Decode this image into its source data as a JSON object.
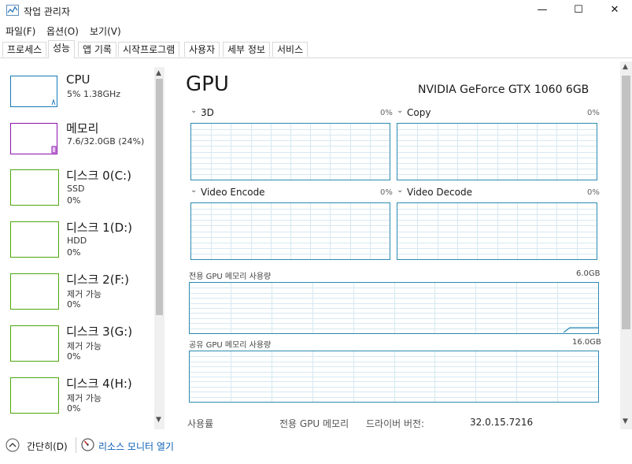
{
  "window": {
    "title": "작업 관리자"
  },
  "menu": [
    "파일(F)",
    "옵션(O)",
    "보기(V)"
  ],
  "tabs": [
    "프로세스",
    "성능",
    "앱 기록",
    "시작프로그램",
    "사용자",
    "세부 정보",
    "서비스"
  ],
  "active_tab": "성능",
  "sidebar": [
    {
      "title": "CPU",
      "line1": "5% 1.38GHz",
      "line2": "",
      "color": "#1779ba"
    },
    {
      "title": "메모리",
      "line1": "7.6/32.0GB (24%)",
      "line2": "",
      "color": "#8b12ae"
    },
    {
      "title": "디스크 0(C:)",
      "line1": "SSD",
      "line2": "0%",
      "color": "#4da60c"
    },
    {
      "title": "디스크 1(D:)",
      "line1": "HDD",
      "line2": "0%",
      "color": "#4da60c"
    },
    {
      "title": "디스크 2(F:)",
      "line1": "제거 가능",
      "line2": "0%",
      "color": "#4da60c"
    },
    {
      "title": "디스크 3(G:)",
      "line1": "제거 가능",
      "line2": "0%",
      "color": "#4da60c"
    },
    {
      "title": "디스크 4(H:)",
      "line1": "제거 가능",
      "line2": "0%",
      "color": "#4da60c"
    }
  ],
  "gpu": {
    "title": "GPU",
    "name": "NVIDIA GeForce GTX 1060 6GB",
    "engines": [
      {
        "label": "3D",
        "pct": "0%"
      },
      {
        "label": "Copy",
        "pct": "0%"
      },
      {
        "label": "Video Encode",
        "pct": "0%"
      },
      {
        "label": "Video Decode",
        "pct": "0%"
      }
    ],
    "dedicated_label": "전용 GPU 메모리 사용량",
    "dedicated_max": "6.0GB",
    "shared_label": "공유 GPU 메모리 사용량",
    "shared_max": "16.0GB",
    "accent": "#2b8ab0"
  },
  "info": {
    "usage_label": "사용률",
    "dedicated_label": "전용 GPU 메모리",
    "driver_label": "드라이버 버전:",
    "driver_value": "32.0.15.7216"
  },
  "footer": {
    "less_details": "간단히(D)",
    "resource_monitor": "리소스 모니터 열기"
  }
}
